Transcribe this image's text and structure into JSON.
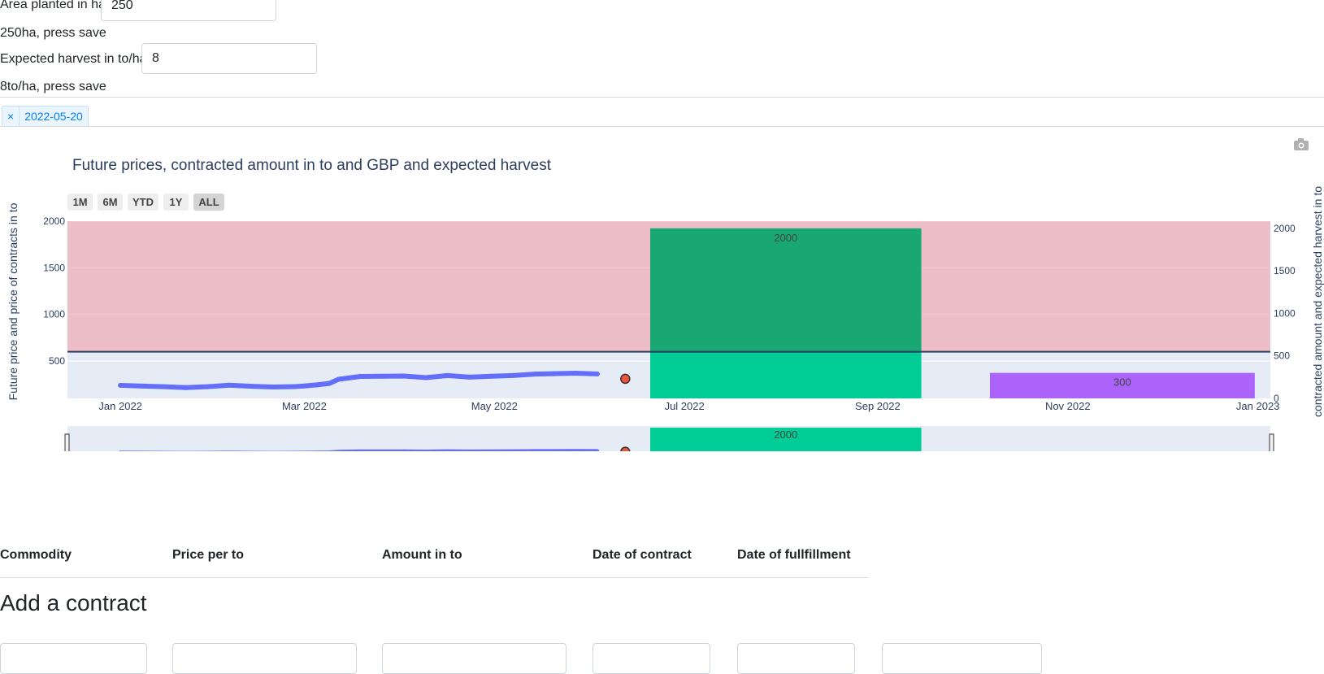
{
  "form": {
    "area_label": "Area planted in ha",
    "area_value": "250",
    "area_status": "250ha, press save",
    "harvest_label": "Expected harvest in to/ha",
    "harvest_value": "8",
    "harvest_status": "8to/ha, press save"
  },
  "date_filter": {
    "remove_symbol": "×",
    "value": "2022-05-20"
  },
  "chart": {
    "camera_icon": "camera-icon",
    "range_buttons": [
      "1M",
      "6M",
      "YTD",
      "1Y",
      "ALL"
    ],
    "active_range": "ALL"
  },
  "chart_data": {
    "type": "line",
    "title": "Future prices, contracted amount in to and GBP and expected harvest",
    "ylabel": "Future price and price of contracts in to",
    "y2label": "contracted amount and expected harvest in to",
    "xlim": [
      "2021-12-15",
      "2023-01-05"
    ],
    "ylim": [
      100,
      2000
    ],
    "y2lim": [
      0,
      2085
    ],
    "x_ticks": [
      "Jan 2022",
      "Mar 2022",
      "May 2022",
      "Jul 2022",
      "Sep 2022",
      "Nov 2022",
      "Jan 2023"
    ],
    "x_tick_dates": [
      "2022-01-01",
      "2022-03-01",
      "2022-05-01",
      "2022-07-01",
      "2022-09-01",
      "2022-11-01",
      "2023-01-01"
    ],
    "y_ticks": [
      500,
      1000,
      1500,
      2000
    ],
    "y2_ticks": [
      0,
      500,
      1000,
      1500,
      2000
    ],
    "expected_harvest_level": 2000,
    "price_threshold": 600,
    "series": [
      {
        "kind": "line",
        "color": "#636efa",
        "x": [
          "2022-01-01",
          "2022-01-08",
          "2022-01-15",
          "2022-01-22",
          "2022-01-29",
          "2022-02-05",
          "2022-02-12",
          "2022-02-19",
          "2022-02-26",
          "2022-03-01",
          "2022-03-05",
          "2022-03-09",
          "2022-03-12",
          "2022-03-19",
          "2022-03-26",
          "2022-04-02",
          "2022-04-09",
          "2022-04-16",
          "2022-04-23",
          "2022-04-30",
          "2022-05-07",
          "2022-05-14",
          "2022-05-20",
          "2022-05-27",
          "2022-06-03"
        ],
        "values": [
          240,
          232,
          225,
          215,
          225,
          242,
          230,
          222,
          226,
          233,
          245,
          260,
          305,
          335,
          338,
          340,
          322,
          345,
          328,
          337,
          345,
          360,
          365,
          370,
          362
        ]
      },
      {
        "kind": "marker",
        "color": "#ef553b",
        "x": [
          "2022-06-12"
        ],
        "values": [
          310
        ]
      },
      {
        "kind": "bar",
        "axis": "y2",
        "color": "#00cc96",
        "x_start": "2022-06-20",
        "x_end": "2022-09-15",
        "value": 2000,
        "label": "2000"
      },
      {
        "kind": "bar",
        "axis": "y2",
        "color": "#ab63fa",
        "x_start": "2022-10-07",
        "x_end": "2022-12-31",
        "value": 300,
        "label": "300"
      }
    ]
  },
  "table": {
    "headers": [
      "Commodity",
      "Price per to",
      "Amount in to",
      "Date of contract",
      "Date of fullfillment"
    ]
  },
  "add_contract": {
    "heading": "Add a contract"
  }
}
